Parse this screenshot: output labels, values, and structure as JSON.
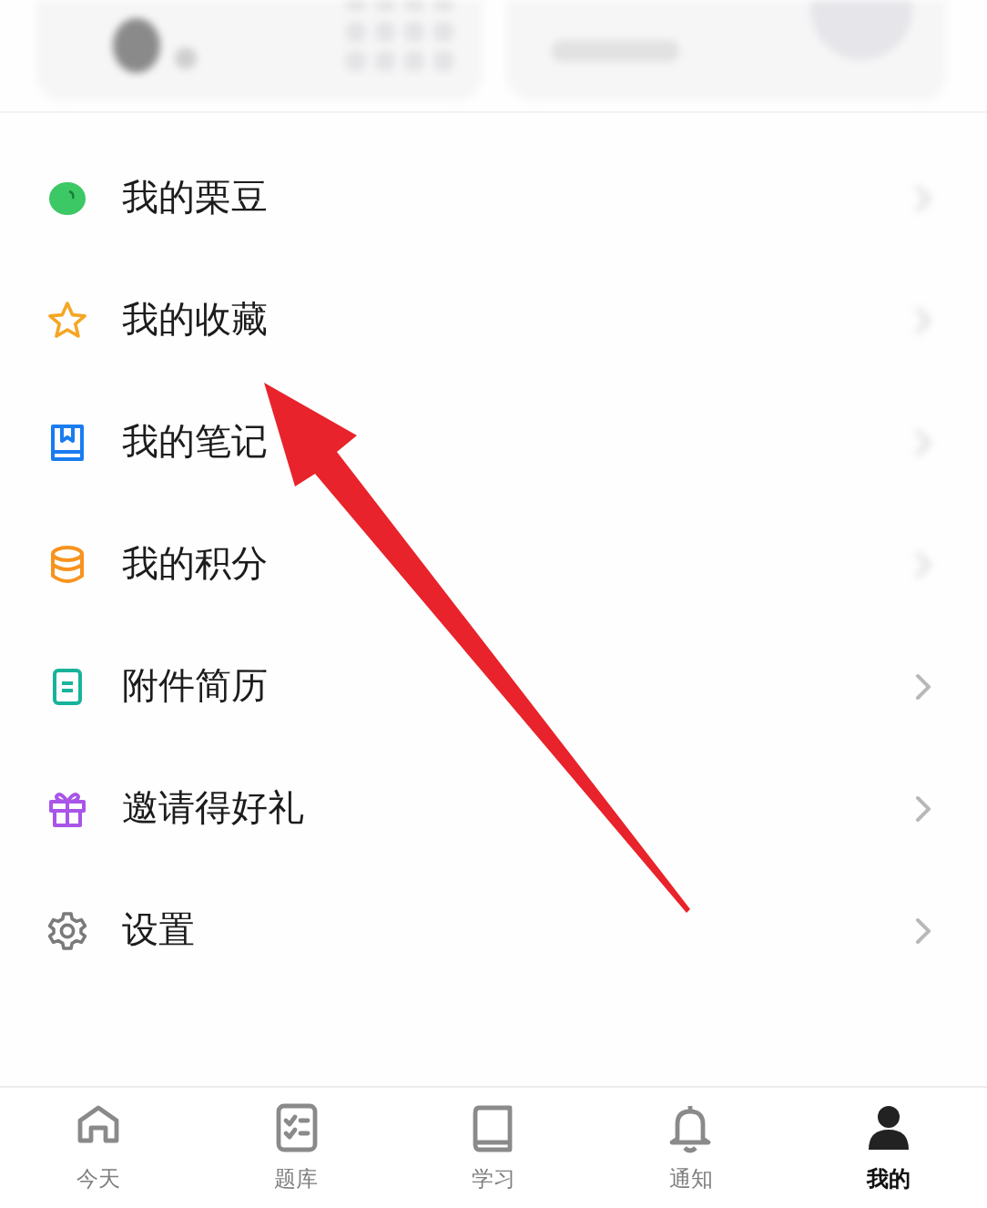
{
  "menu": [
    {
      "label": "我的栗豆",
      "kind": "bean",
      "color": "#3cc864",
      "right_blurred": true
    },
    {
      "label": "我的收藏",
      "kind": "star",
      "color": "#f5a623",
      "right_blurred": true
    },
    {
      "label": "我的笔记",
      "kind": "notebook",
      "color": "#1a7cf0",
      "right_blurred": true
    },
    {
      "label": "我的积分",
      "kind": "coins",
      "color": "#f7931e",
      "right_blurred": true
    },
    {
      "label": "附件简历",
      "kind": "document",
      "color": "#17b39b",
      "right_blurred": false
    },
    {
      "label": "邀请得好礼",
      "kind": "gift",
      "color": "#a855e8",
      "right_blurred": false
    },
    {
      "label": "设置",
      "kind": "gear",
      "color": "#7a7a7a",
      "right_blurred": false
    }
  ],
  "tab_bar": [
    {
      "label": "今天",
      "kind": "home",
      "selected": false
    },
    {
      "label": "题库",
      "kind": "checklist",
      "selected": false
    },
    {
      "label": "学习",
      "kind": "book",
      "selected": false
    },
    {
      "label": "通知",
      "kind": "bell",
      "selected": false
    },
    {
      "label": "我的",
      "kind": "person",
      "selected": true
    }
  ]
}
